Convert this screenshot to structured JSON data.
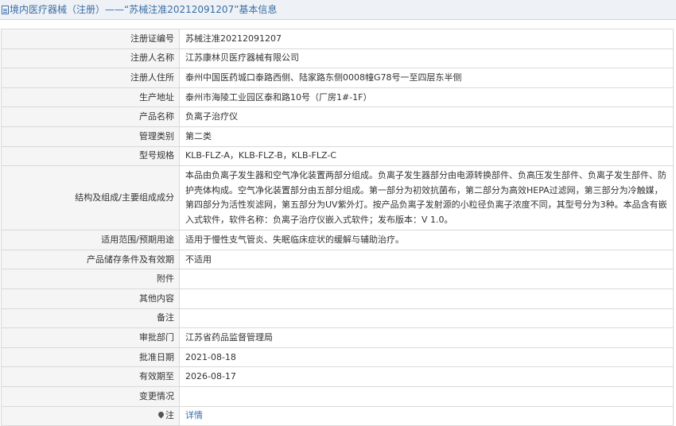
{
  "header": {
    "title": "境内医疗器械（注册）——“苏械注准20212091207”基本信息"
  },
  "rows": [
    {
      "label": "注册证编号",
      "value": "苏械注准20212091207"
    },
    {
      "label": "注册人名称",
      "value": "江苏康林贝医疗器械有限公司"
    },
    {
      "label": "注册人住所",
      "value": "泰州中国医药城口泰路西侧、陆家路东侧0008幢G78号一至四层东半侧"
    },
    {
      "label": "生产地址",
      "value": "泰州市海陵工业园区泰和路10号（厂房1#-1F）"
    },
    {
      "label": "产品名称",
      "value": "负离子治疗仪"
    },
    {
      "label": "管理类别",
      "value": "第二类"
    },
    {
      "label": "型号规格",
      "value": "KLB-FLZ-A，KLB-FLZ-B，KLB-FLZ-C"
    },
    {
      "label": "结构及组成/主要组成成分",
      "value": "本品由负离子发生器和空气净化装置两部分组成。负离子发生器部分由电源转换部件、负高压发生部件、负离子发生部件、防护壳体构成。空气净化装置部分由五部分组成。第一部分为初效抗菌布，第二部分为高效HEPA过滤网，第三部分为冷触媒，第四部分为活性炭滤网，第五部分为UV紫外灯。按产品负离子发射源的小粒径负离子浓度不同，其型号分为3种。本品含有嵌入式软件，软件名称：负离子治疗仪嵌入式软件；发布版本：V 1.0。"
    },
    {
      "label": "适用范围/预期用途",
      "value": "适用于慢性支气管炎、失眠临床症状的缓解与辅助治疗。"
    },
    {
      "label": "产品储存条件及有效期",
      "value": "不适用"
    },
    {
      "label": "附件",
      "value": ""
    },
    {
      "label": "其他内容",
      "value": ""
    },
    {
      "label": "备注",
      "value": ""
    },
    {
      "label": "审批部门",
      "value": "江苏省药品监督管理局"
    },
    {
      "label": "批准日期",
      "value": "2021-08-18"
    },
    {
      "label": "有效期至",
      "value": "2026-08-17"
    },
    {
      "label": "变更情况",
      "value": ""
    }
  ],
  "footer_row": {
    "label": "注",
    "link_text": "详情",
    "icon": "pin-icon"
  },
  "colors": {
    "title": "#3a6ea5",
    "label_bg": "#f5f5f5",
    "border": "#d9d9d9",
    "link": "#3a6ea5"
  }
}
